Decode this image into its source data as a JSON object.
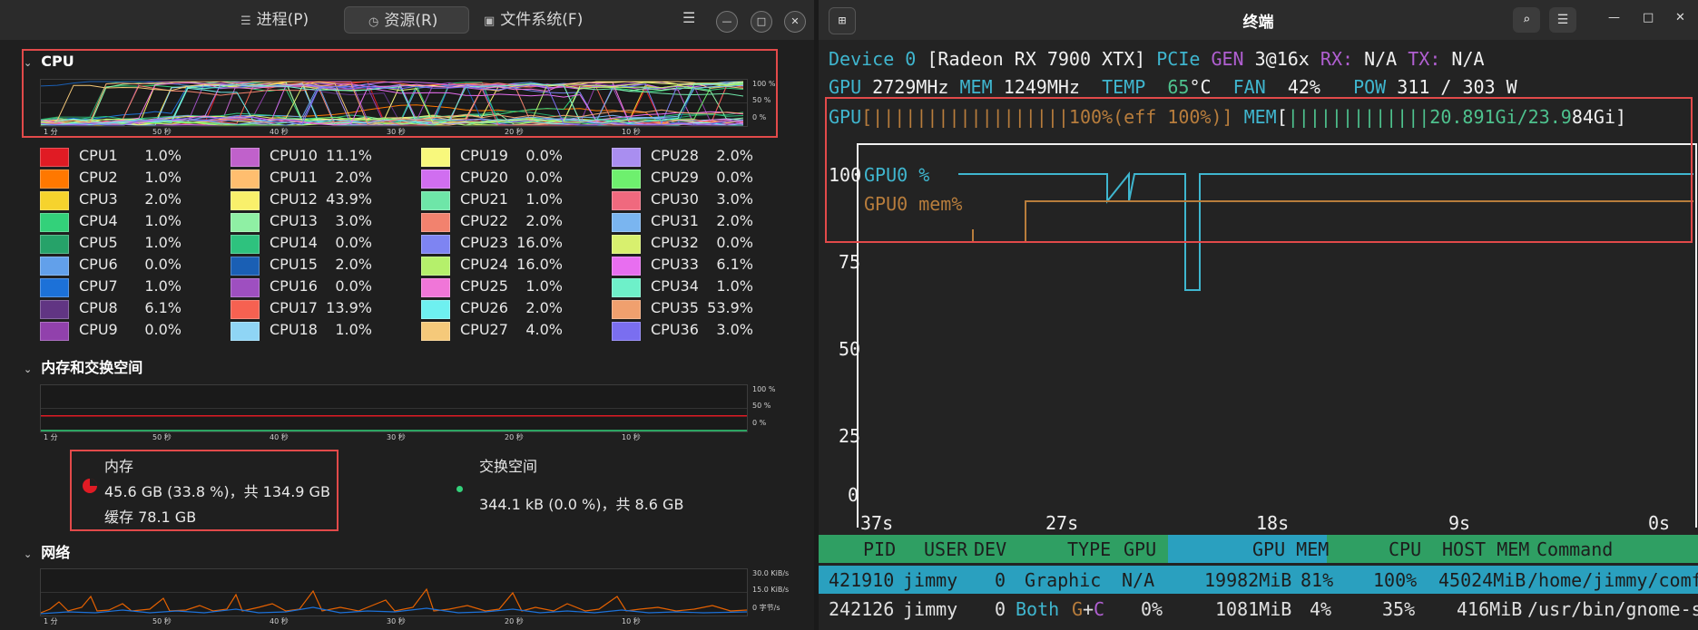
{
  "sysmon": {
    "tabs": [
      {
        "icon": "☰",
        "label": "进程(P)"
      },
      {
        "icon": "◷",
        "label": "资源(R)"
      },
      {
        "icon": "▣",
        "label": "文件系统(F)"
      }
    ],
    "cpu": {
      "title": "CPU",
      "y_ticks": [
        "100 %",
        "50 %",
        "0 %"
      ],
      "x_ticks": [
        "1 分",
        "50 秒",
        "40 秒",
        "30 秒",
        "20 秒",
        "10 秒"
      ],
      "cores": [
        {
          "name": "CPU1",
          "value": "1.0%",
          "color": "#e01b24"
        },
        {
          "name": "CPU2",
          "value": "1.0%",
          "color": "#ff7800"
        },
        {
          "name": "CPU3",
          "value": "2.0%",
          "color": "#f6d32d"
        },
        {
          "name": "CPU4",
          "value": "1.0%",
          "color": "#33d17a"
        },
        {
          "name": "CPU5",
          "value": "1.0%",
          "color": "#26a269"
        },
        {
          "name": "CPU6",
          "value": "0.0%",
          "color": "#62a0ea"
        },
        {
          "name": "CPU7",
          "value": "1.0%",
          "color": "#1c71d8"
        },
        {
          "name": "CPU8",
          "value": "6.1%",
          "color": "#613583"
        },
        {
          "name": "CPU9",
          "value": "0.0%",
          "color": "#9141ac"
        },
        {
          "name": "CPU10",
          "value": "11.1%",
          "color": "#c061cb"
        },
        {
          "name": "CPU11",
          "value": "2.0%",
          "color": "#ffbe6f"
        },
        {
          "name": "CPU12",
          "value": "43.9%",
          "color": "#f9f06b"
        },
        {
          "name": "CPU13",
          "value": "3.0%",
          "color": "#8ff0a4"
        },
        {
          "name": "CPU14",
          "value": "0.0%",
          "color": "#2ec27e"
        },
        {
          "name": "CPU15",
          "value": "2.0%",
          "color": "#1a5fb4"
        },
        {
          "name": "CPU16",
          "value": "0.0%",
          "color": "#9e4fc0"
        },
        {
          "name": "CPU17",
          "value": "13.9%",
          "color": "#f66151"
        },
        {
          "name": "CPU18",
          "value": "1.0%",
          "color": "#8fd5f5"
        },
        {
          "name": "CPU19",
          "value": "0.0%",
          "color": "#f8f87c"
        },
        {
          "name": "CPU20",
          "value": "0.0%",
          "color": "#d06ef0"
        },
        {
          "name": "CPU21",
          "value": "1.0%",
          "color": "#6ee6a8"
        },
        {
          "name": "CPU22",
          "value": "2.0%",
          "color": "#f2826e"
        },
        {
          "name": "CPU23",
          "value": "16.0%",
          "color": "#7e84f2"
        },
        {
          "name": "CPU24",
          "value": "16.0%",
          "color": "#b5f06b"
        },
        {
          "name": "CPU25",
          "value": "1.0%",
          "color": "#f076d8"
        },
        {
          "name": "CPU26",
          "value": "2.0%",
          "color": "#6ef0f0"
        },
        {
          "name": "CPU27",
          "value": "4.0%",
          "color": "#f5c97a"
        },
        {
          "name": "CPU28",
          "value": "2.0%",
          "color": "#a98ef0"
        },
        {
          "name": "CPU29",
          "value": "0.0%",
          "color": "#6ef06e"
        },
        {
          "name": "CPU30",
          "value": "3.0%",
          "color": "#f0697e"
        },
        {
          "name": "CPU31",
          "value": "2.0%",
          "color": "#7ab5f0"
        },
        {
          "name": "CPU32",
          "value": "0.0%",
          "color": "#d8f06e"
        },
        {
          "name": "CPU33",
          "value": "6.1%",
          "color": "#e86ef0"
        },
        {
          "name": "CPU34",
          "value": "1.0%",
          "color": "#6ef0c9"
        },
        {
          "name": "CPU35",
          "value": "53.9%",
          "color": "#f0a06e"
        },
        {
          "name": "CPU36",
          "value": "3.0%",
          "color": "#7a6ef0"
        }
      ]
    },
    "memory": {
      "title": "内存和交换空间",
      "y_ticks": [
        "100 %",
        "50 %",
        "0 %"
      ],
      "x_ticks": [
        "1 分",
        "50 秒",
        "40 秒",
        "30 秒",
        "20 秒",
        "10 秒"
      ],
      "mem_label": "内存",
      "mem_usage": "45.6 GB (33.8 %)，共 134.9 GB",
      "mem_cache": "缓存 78.1 GB",
      "mem_percent": 33.8,
      "swap_label": "交换空间",
      "swap_usage": "344.1 kB (0.0 %)，共 8.6 GB"
    },
    "network": {
      "title": "网络",
      "y_ticks": [
        "30.0 KiB/s",
        "15.0 KiB/s",
        "0 字节/s"
      ],
      "x_ticks": [
        "1 分",
        "50 秒",
        "40 秒",
        "30 秒",
        "20 秒",
        "10 秒"
      ]
    }
  },
  "terminal": {
    "title": "终端",
    "line1": {
      "device": "Device 0",
      "name": "[Radeon RX 7900 XTX]",
      "pcie": "PCIe",
      "gen": "GEN",
      "gen_val": "3@16x",
      "rx": "RX:",
      "rx_val": "N/A",
      "tx": "TX:",
      "tx_val": "N/A"
    },
    "line2": {
      "gpu": "GPU",
      "gpu_val": "2729MHz",
      "mem": "MEM",
      "mem_val": "1249MHz",
      "temp": "TEMP",
      "temp_val": "65",
      "temp_unit": "°C",
      "fan": "FAN",
      "fan_val": "42%",
      "pow": "POW",
      "pow_val": "311 / 303 W"
    },
    "line3": {
      "gpu": "GPU",
      "gpu_bar": "[||||||||||||||||||100%(eff 100%)]",
      "mem": "MEM",
      "mem_bar_open": "[",
      "mem_bar_bars": "|||||||||||||",
      "mem_bar_val": "20.891Gi/23.9",
      "mem_bar_tail": "84Gi]"
    },
    "plot": {
      "y_ticks": [
        "100",
        "75",
        "50",
        "25",
        "0"
      ],
      "x_ticks": [
        "37s",
        "27s",
        "18s",
        "9s",
        "0s"
      ],
      "legend": [
        "GPU0 %",
        "GPU0 mem%"
      ]
    },
    "proc_header": [
      "PID",
      "USER",
      "DEV",
      "TYPE",
      "GPU",
      "GPU MEM",
      "CPU",
      "HOST MEM",
      "Command"
    ],
    "processes": [
      {
        "pid": "421910",
        "user": "jimmy",
        "dev": "0",
        "type": "Graphic",
        "gpu": "N/A",
        "gpu_mem": "19982MiB",
        "gpu_mem_pct": "81%",
        "cpu": "100%",
        "host_mem": "45024MiB",
        "cmd": "/home/jimmy/comf"
      },
      {
        "pid": "242126",
        "user": "jimmy",
        "dev": "0",
        "type_a": "Both",
        "type_b": "G",
        "type_plus": "+",
        "type_c": "C",
        "gpu": "0%",
        "gpu_mem": "1081MiB",
        "gpu_mem_pct": "4%",
        "cpu": "35%",
        "host_mem": "416MiB",
        "cmd": "/usr/bin/gnome-s"
      }
    ]
  }
}
